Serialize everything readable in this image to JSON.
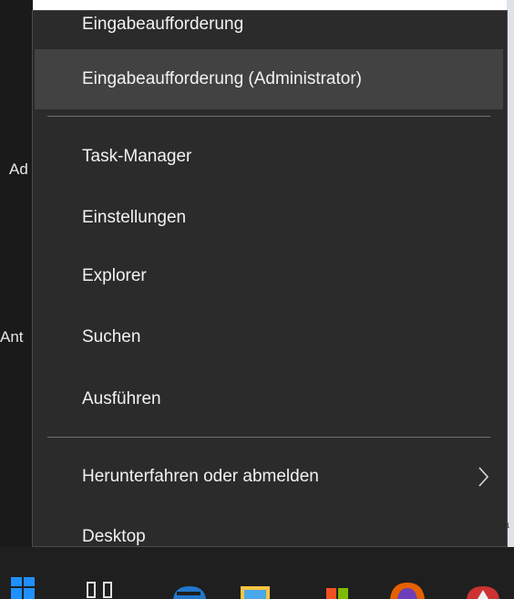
{
  "background": {
    "left_text_1": "Ad",
    "left_text_2": "Ant",
    "right_text": "a"
  },
  "menu": {
    "items": [
      {
        "label": "Eingabeaufforderung",
        "highlighted": false
      },
      {
        "label": "Eingabeaufforderung (Administrator)",
        "highlighted": true
      },
      {
        "label": "Task-Manager",
        "highlighted": false
      },
      {
        "label": "Einstellungen",
        "highlighted": false
      },
      {
        "label": "Explorer",
        "highlighted": false
      },
      {
        "label": "Suchen",
        "highlighted": false
      },
      {
        "label": "Ausführen",
        "highlighted": false
      },
      {
        "label": "Herunterfahren oder abmelden",
        "highlighted": false,
        "submenu": true
      },
      {
        "label": "Desktop",
        "highlighted": false
      }
    ]
  },
  "taskbar": {
    "icons": [
      "windows-start-icon",
      "task-view-icon",
      "edge-icon",
      "file-explorer-icon",
      "store-icon",
      "firefox-icon",
      "app-icon"
    ]
  },
  "colors": {
    "menu_bg": "#2b2b2b",
    "highlight": "#424242",
    "text": "#f2f2f2",
    "separator": "#707070"
  }
}
